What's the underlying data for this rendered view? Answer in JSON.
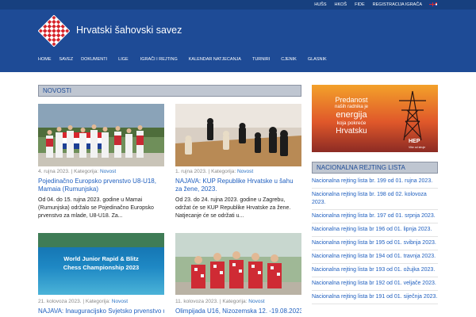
{
  "topbar": {
    "links": [
      "HUŠS",
      "HKOŠ",
      "FIDE",
      "REGISTRACIJA IGRAČA"
    ]
  },
  "site": {
    "title": "Hrvatski šahovski savez"
  },
  "nav": {
    "items": [
      "HOME",
      "SAVEZ",
      "DOKUMENTI",
      "LIGE",
      "IGRAČI I REJTING",
      "KALENDAR NATJECANJA",
      "TURNIRI",
      "CJENIK",
      "GLASNIK"
    ]
  },
  "news": {
    "heading": "NOVOSTI",
    "articles": [
      {
        "date": "4. rujna 2023.",
        "category_label": "Kategorija:",
        "category": "Novost",
        "title": "Pojedinačno Europsko prvenstvo U8-U18, Mamaia (Rumunjska)",
        "excerpt": "Od 04. do 15. rujna 2023. godine u Mamai (Rumunjska) održalo se Pojedinačno Europsko prvenstvo za mlade, U8-U18. Za..."
      },
      {
        "date": "1. rujna 2023.",
        "category_label": "Kategorija:",
        "category": "Novost",
        "title": "NAJAVA: KUP Republike Hrvatske u šahu za žene, 2023.",
        "excerpt": "Od 23. do 24. rujna 2023. godine u Zagrebu, održat će se KUP Republike Hrvatske za žene. Natjecanje će se održati u..."
      },
      {
        "date": "21. kolovoza 2023.",
        "category_label": "Kategorija:",
        "category": "Novost",
        "title": "NAJAVA: Inauguracijsko Svjetsko prvenstvo u",
        "image_text": [
          "World Junior Rapid & Blitz",
          "Chess Championship 2023"
        ]
      },
      {
        "date": "11. kolovoza 2023.",
        "category_label": "Kategorija:",
        "category": "Novost",
        "title": "Olimpijada U16, Nizozemska 12. -19.08.2023."
      }
    ]
  },
  "ad": {
    "lines": [
      "Predanost",
      "naših radnika je",
      "energija",
      "koja pokreće",
      "Hrvatsku"
    ],
    "brand": "HEP",
    "brand_sub": "Više od struje"
  },
  "ratings": {
    "heading": "NACIONALNA REJTING LISTA",
    "items": [
      "Nacionalna rejting lista br. 199 od 01. rujna 2023.",
      "Nacionalna rejting lista br. 198 od 02. kolovoza 2023.",
      "Nacionalna rejting lista br. 197 od 01. srpnja 2023.",
      "Nacionalna rejting lista br 196 od 01. lipnja 2023.",
      "Nacionalna rejting lista br 195 od 01. svibnja 2023.",
      "Nacionalna rejting lista br 194 od 01. travnja 2023.",
      "Nacionalna rejting lista br 193 od 01. ožujka 2023.",
      "Nacionalna rejting lista br 192 od 01. veljače 2023.",
      "Nacionalna rejting lista br 191 od 01. siječnja 2023."
    ]
  },
  "colors": {
    "header": "#1e4b96",
    "link": "#1f5fbf",
    "section_head": "#bfc6d1"
  }
}
